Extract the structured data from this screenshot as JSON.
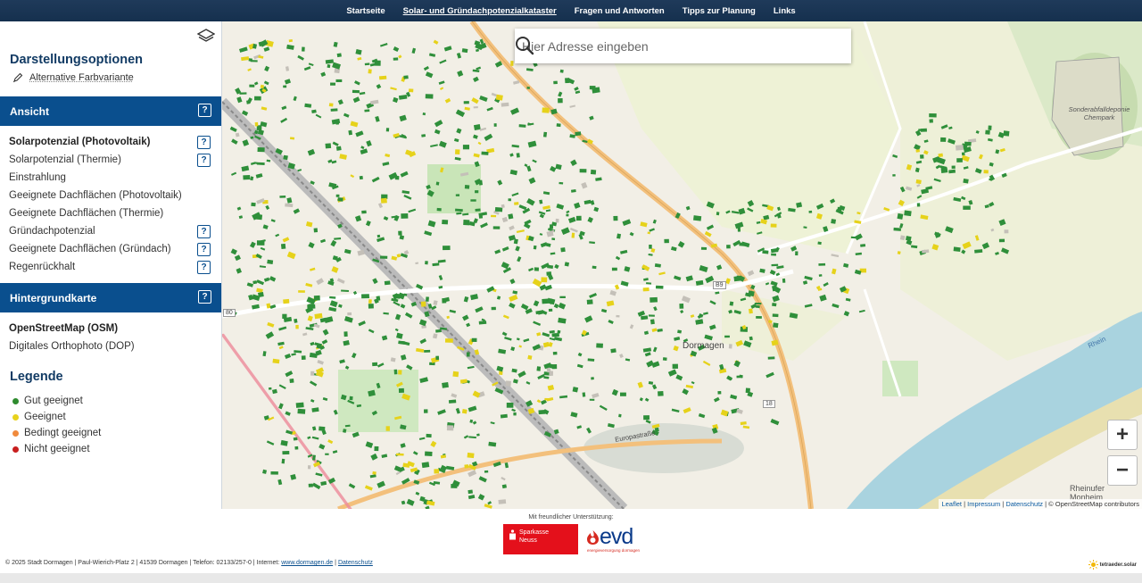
{
  "nav": {
    "items": [
      "Startseite",
      "Solar- und Gründachpotenzialkataster",
      "Fragen und Antworten",
      "Tipps zur Planung",
      "Links"
    ],
    "active_index": 1
  },
  "sidebar": {
    "title": "Darstellungsoptionen",
    "alt_color_label": "Alternative Farbvariante",
    "ansicht": {
      "header": "Ansicht",
      "help": "?",
      "options": [
        {
          "label": "Solarpotenzial (Photovoltaik)",
          "selected": true,
          "help": true
        },
        {
          "label": "Solarpotenzial (Thermie)",
          "selected": false,
          "help": true
        },
        {
          "label": "Einstrahlung",
          "selected": false,
          "help": false
        },
        {
          "label": "Geeignete Dachflächen (Photovoltaik)",
          "selected": false,
          "help": false
        },
        {
          "label": "Geeignete Dachflächen (Thermie)",
          "selected": false,
          "help": false
        },
        {
          "label": "Gründachpotenzial",
          "selected": false,
          "help": true
        },
        {
          "label": "Geeignete Dachflächen (Gründach)",
          "selected": false,
          "help": true
        },
        {
          "label": "Regenrückhalt",
          "selected": false,
          "help": true
        }
      ]
    },
    "hintergrund": {
      "header": "Hintergrundkarte",
      "help": "?",
      "options": [
        {
          "label": "OpenStreetMap (OSM)",
          "selected": true
        },
        {
          "label": "Digitales Orthophoto (DOP)",
          "selected": false
        }
      ]
    },
    "legend": {
      "title": "Legende",
      "items": [
        {
          "label": "Gut geeignet",
          "color": "#2e8b2e"
        },
        {
          "label": "Geeignet",
          "color": "#e8d21c"
        },
        {
          "label": "Bedingt geeignet",
          "color": "#f08a3c"
        },
        {
          "label": "Nicht geeignet",
          "color": "#c81e1e"
        }
      ]
    }
  },
  "map": {
    "search_placeholder": "Hier Adresse eingeben",
    "zoom_in": "+",
    "zoom_out": "−",
    "labels": {
      "town": "Dormagen",
      "deponie": "Sonderabfalldeponie Chempark",
      "rheinufer": "Rheinufer Monheim",
      "europastrasse": "Europastraße",
      "rhein": "Rhein",
      "b9": "B9",
      "n18": "18",
      "n80": "80"
    },
    "attribution": {
      "leaflet": "Leaflet",
      "impressum": "Impressum",
      "datenschutz": "Datenschutz",
      "copyright": "© OpenStreetMap contributors"
    }
  },
  "footer": {
    "support_text": "Mit freundlicher Unterstützung:",
    "sparkasse_line1": "Sparkasse",
    "sparkasse_line2": "Neuss",
    "evd_word": "evd",
    "evd_sub": "energieversorgung dormagen",
    "legal_text": "© 2025 Stadt Dormagen | Paul-Wierich-Platz 2 | 41539 Dormagen | Telefon: 02133/257-0 | Internet:",
    "legal_link": "www.dormagen.de",
    "legal_sep": "|",
    "legal_privacy": "Datenschutz",
    "brand": "tetraeder.solar"
  },
  "colors": {
    "nav_bg": "#1f3a5a",
    "band_bg": "#0a4f8e",
    "title": "#123b64",
    "building_green": "#2f8f3a",
    "building_yellow": "#e6d21a",
    "river": "#a9d3df"
  }
}
